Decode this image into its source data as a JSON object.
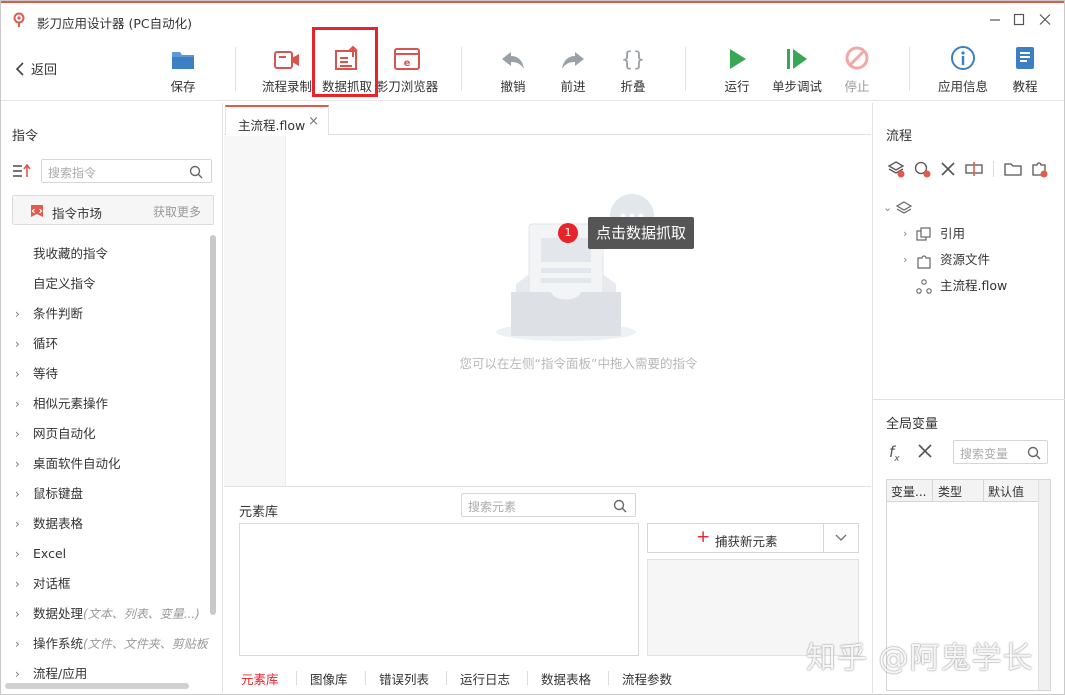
{
  "app": {
    "title": "影刀应用设计器 (PC自动化)",
    "accent": "#e05a4e",
    "highlight": "#e8232a"
  },
  "toolbar": {
    "back": "返回",
    "save": "保存",
    "record": "流程录制",
    "data_capture": "数据抓取",
    "browser": "影刀浏览器",
    "undo": "撤销",
    "redo": "前进",
    "fold": "折叠",
    "run": "运行",
    "step_debug": "单步调试",
    "stop": "停止",
    "app_info": "应用信息",
    "tutorial": "教程"
  },
  "left": {
    "title": "指令",
    "search_placeholder": "搜索指令",
    "market_label": "指令市场",
    "market_more": "获取更多",
    "items": [
      {
        "label": "我收藏的指令",
        "hint": "",
        "expandable": false
      },
      {
        "label": "自定义指令",
        "hint": "",
        "expandable": false
      },
      {
        "label": "条件判断",
        "hint": "",
        "expandable": true
      },
      {
        "label": "循环",
        "hint": "",
        "expandable": true
      },
      {
        "label": "等待",
        "hint": "",
        "expandable": true
      },
      {
        "label": "相似元素操作",
        "hint": "",
        "expandable": true
      },
      {
        "label": "网页自动化",
        "hint": "",
        "expandable": true
      },
      {
        "label": "桌面软件自动化",
        "hint": "",
        "expandable": true
      },
      {
        "label": "鼠标键盘",
        "hint": "",
        "expandable": true
      },
      {
        "label": "数据表格",
        "hint": "",
        "expandable": true
      },
      {
        "label": "Excel",
        "hint": "",
        "expandable": true
      },
      {
        "label": "对话框",
        "hint": "",
        "expandable": true
      },
      {
        "label": "数据处理",
        "hint": "(文本、列表、变量...)",
        "expandable": true
      },
      {
        "label": "操作系统",
        "hint": "(文件、文件夹、剪贴板",
        "expandable": true
      },
      {
        "label": "流程/应用",
        "hint": "",
        "expandable": true
      }
    ]
  },
  "center": {
    "tab_label": "主流程.flow",
    "tab_close": "×",
    "callout_number": "1",
    "callout_text": "点击数据抓取",
    "empty_text": "您可以在左侧“指令面板”中拖入需要的指令",
    "element_library_title": "元素库",
    "element_search_placeholder": "搜索元素",
    "capture_label": "捕获新元素",
    "bottom_tabs": [
      "元素库",
      "图像库",
      "错误列表",
      "运行日志",
      "数据表格",
      "流程参数"
    ]
  },
  "right": {
    "flow_title": "流程",
    "tree": {
      "ref": "引用",
      "resources": "资源文件",
      "main_flow": "主流程.flow"
    },
    "globals_title": "全局变量",
    "globals_search_placeholder": "搜索变量",
    "table_headers": [
      "变量...",
      "类型",
      "默认值"
    ]
  },
  "watermark": "知乎 @阿鬼学长"
}
